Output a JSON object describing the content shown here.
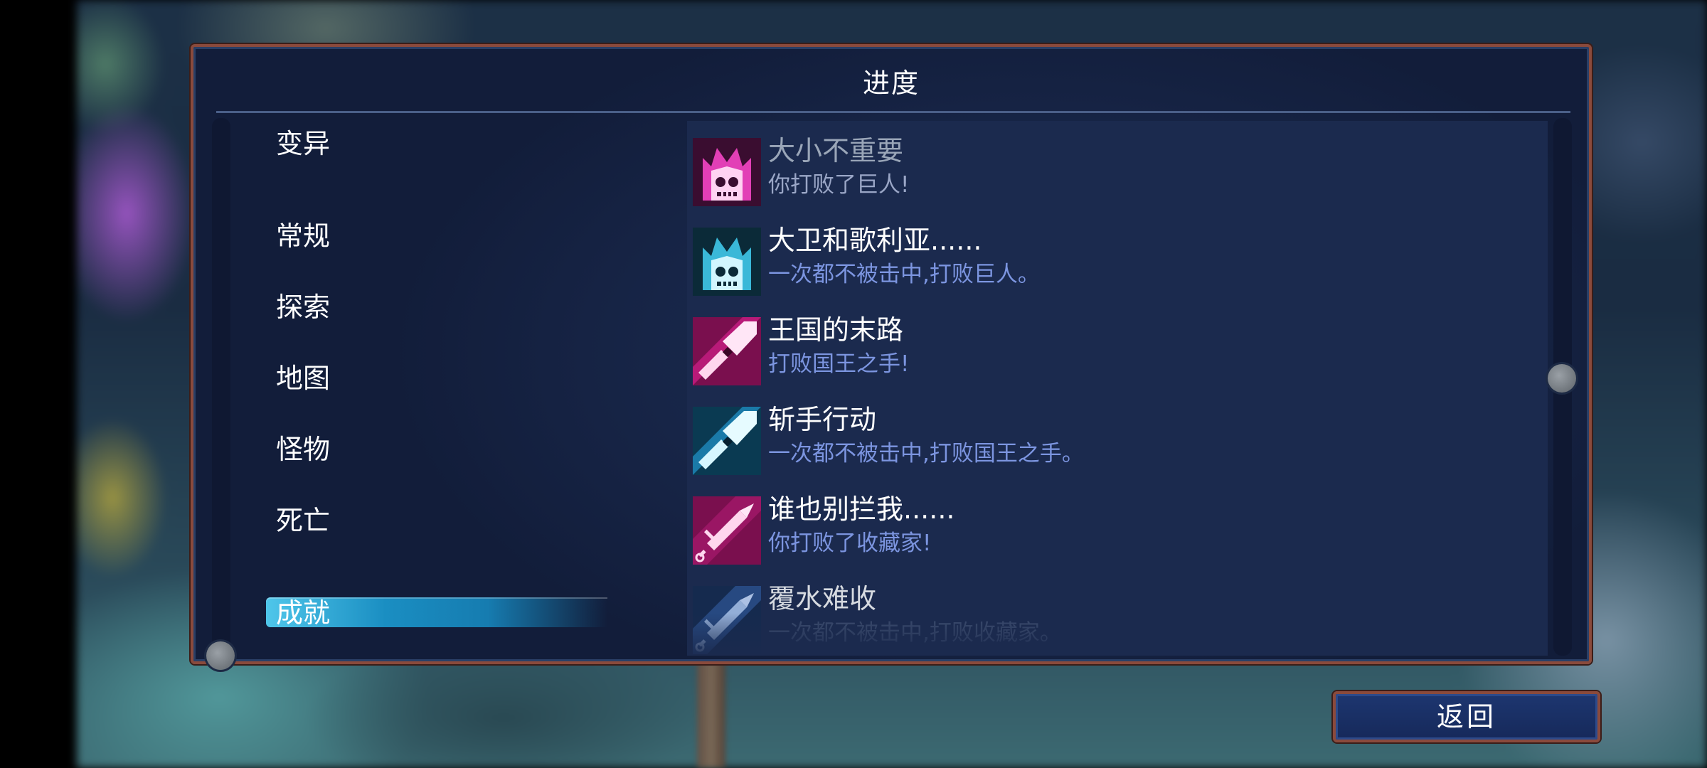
{
  "dialog": {
    "title": "进度"
  },
  "categories": [
    {
      "label": "变异"
    },
    {
      "label": "常规"
    },
    {
      "label": "探索"
    },
    {
      "label": "地图"
    },
    {
      "label": "怪物"
    },
    {
      "label": "死亡"
    },
    {
      "label": "成就",
      "selected": true
    }
  ],
  "achievements": [
    {
      "title": "大小不重要",
      "desc": "你打败了巨人!",
      "icon": "skull-crown-icon",
      "color": "#e23fb6",
      "state": "locked"
    },
    {
      "title": "大卫和歌利亚......",
      "desc": "一次都不被击中,打败巨人。",
      "icon": "skull-crown-icon",
      "color": "#3ab8d8",
      "state": "unlocked"
    },
    {
      "title": "王国的末路",
      "desc": "打败国王之手!",
      "icon": "blade-icon",
      "color": "#e23fb6",
      "state": "unlocked"
    },
    {
      "title": "斩手行动",
      "desc": "一次都不被击中,打败国王之手。",
      "icon": "blade-icon",
      "color": "#3ab8d8",
      "state": "unlocked"
    },
    {
      "title": "谁也别拦我......",
      "desc": "你打败了收藏家!",
      "icon": "syringe-icon",
      "color": "#e23fb6",
      "state": "unlocked"
    },
    {
      "title": "覆水难收",
      "desc": "一次都不被击中,打败收藏家。",
      "icon": "syringe-icon",
      "color": "#3a6fc8",
      "state": "faded"
    }
  ],
  "back_button": {
    "label": "返回"
  }
}
